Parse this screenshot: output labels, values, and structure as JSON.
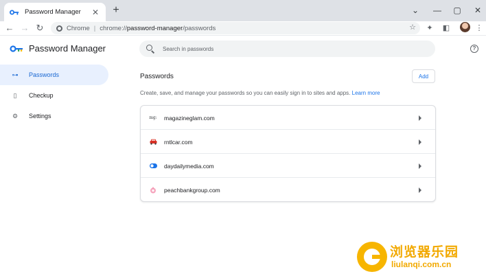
{
  "tab": {
    "title": "Password Manager",
    "close": "✕",
    "new_tab": "+"
  },
  "window_controls": {
    "dropdown": "⌄",
    "minimize": "—",
    "maximize": "▢",
    "close": "✕"
  },
  "toolbar": {
    "back": "←",
    "forward": "→",
    "reload": "↻",
    "omnibox_label": "Chrome",
    "omnibox_separator": "|",
    "omnibox_scheme": "chrome://",
    "omnibox_host": "password-manager",
    "omnibox_path": "/passwords",
    "bookmark": "☆",
    "extensions": "✦",
    "sidepanel": "◧",
    "menu": "⋮"
  },
  "app": {
    "title": "Password Manager",
    "help": "?"
  },
  "search": {
    "placeholder": "Search in passwords"
  },
  "sidebar": {
    "items": [
      {
        "label": "Passwords",
        "icon": "key-icon",
        "glyph": "⊶",
        "active": true
      },
      {
        "label": "Checkup",
        "icon": "checkup-icon",
        "glyph": "▯",
        "active": false
      },
      {
        "label": "Settings",
        "icon": "gear-icon",
        "glyph": "⚙",
        "active": false
      }
    ]
  },
  "main": {
    "title": "Passwords",
    "add_label": "Add",
    "description": "Create, save, and manage your passwords so you can easily sign in to sites and apps.",
    "learn_more": "Learn more",
    "sites": [
      {
        "name": "magazineglam.com",
        "favicon": "mg-favicon",
        "favicon_text": "mg:"
      },
      {
        "name": "rntlcar.com",
        "favicon": "car-favicon",
        "color": "#d93025"
      },
      {
        "name": "daydailymedia.com",
        "favicon": "toggle-favicon",
        "color": "#1a73e8"
      },
      {
        "name": "peachbankgroup.com",
        "favicon": "peach-favicon",
        "color": "#ee7ca0"
      }
    ]
  },
  "colors": {
    "accent": "#1a73e8",
    "active_bg": "#e8f0fe",
    "watermark": "#f2a900"
  },
  "watermark": {
    "cn": "浏览器乐园",
    "en": "liulanqi.com.cn"
  }
}
